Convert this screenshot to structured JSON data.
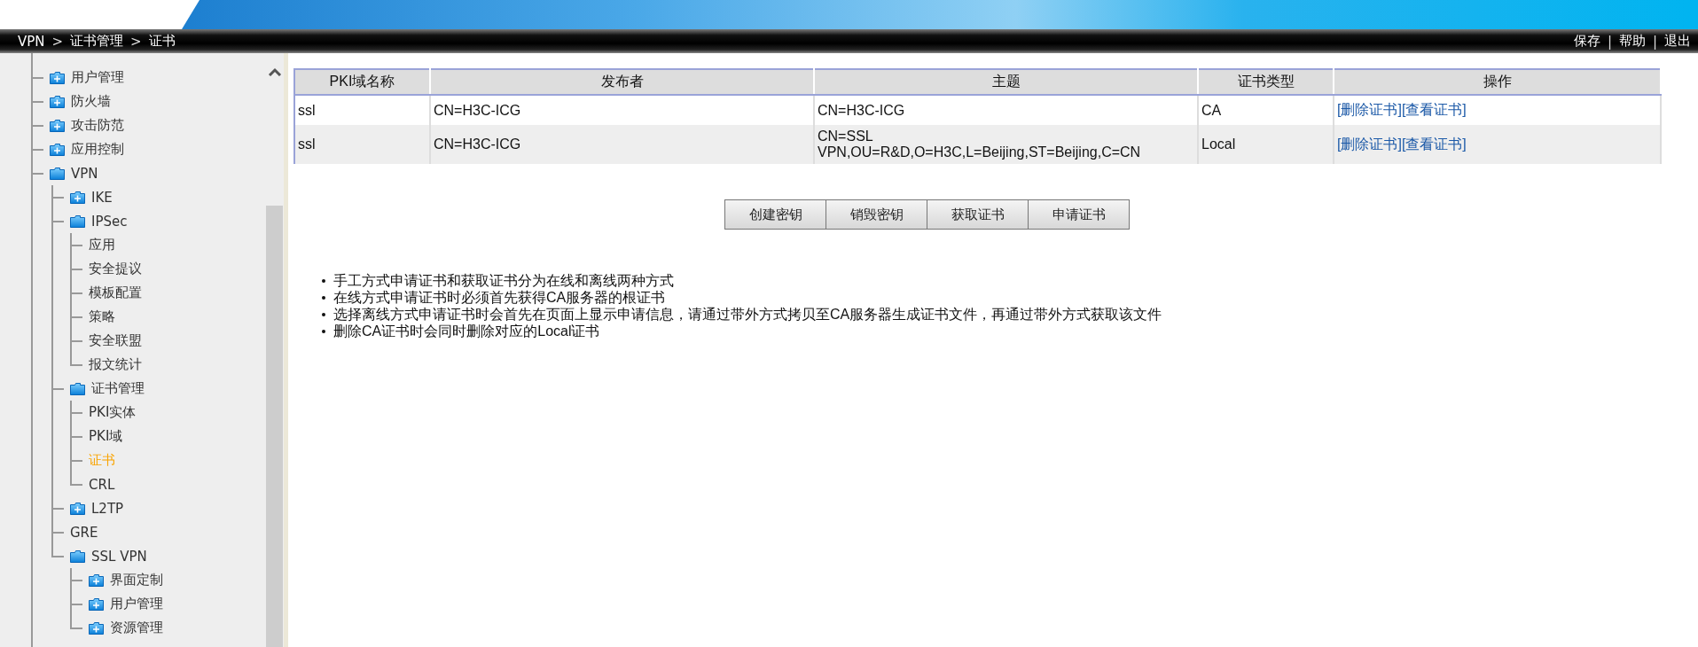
{
  "breadcrumb": [
    {
      "kind": "link",
      "text": "VPN"
    },
    {
      "kind": "separator",
      "text": ">"
    },
    {
      "kind": "link",
      "text": "证书管理"
    },
    {
      "kind": "separator",
      "text": ">"
    },
    {
      "kind": "current",
      "text": "证书"
    }
  ],
  "header_links": [
    {
      "kind": "link",
      "text": "保存"
    },
    {
      "kind": "separator",
      "text": "|"
    },
    {
      "kind": "link",
      "text": "帮助"
    },
    {
      "kind": "separator",
      "text": "|"
    },
    {
      "kind": "link",
      "text": "退出"
    }
  ],
  "sidebar": {
    "items": [
      {
        "label": "用户管理",
        "expanded": false,
        "selected": false
      },
      {
        "label": "防火墙",
        "expanded": false,
        "selected": false
      },
      {
        "label": "攻击防范",
        "expanded": false,
        "selected": false
      },
      {
        "label": "应用控制",
        "expanded": false,
        "selected": false
      },
      {
        "label": "VPN",
        "expanded": true,
        "selected": false,
        "children": [
          {
            "label": "IKE",
            "expanded": false,
            "selected": false
          },
          {
            "label": "IPSec",
            "expanded": true,
            "selected": false,
            "children": [
              {
                "label": "应用",
                "selected": false
              },
              {
                "label": "安全提议",
                "selected": false
              },
              {
                "label": "模板配置",
                "selected": false
              },
              {
                "label": "策略",
                "selected": false
              },
              {
                "label": "安全联盟",
                "selected": false
              },
              {
                "label": "报文统计",
                "selected": false
              }
            ]
          },
          {
            "label": "证书管理",
            "expanded": true,
            "selected": false,
            "children": [
              {
                "label": "PKI实体",
                "selected": false
              },
              {
                "label": "PKI域",
                "selected": false
              },
              {
                "label": "证书",
                "selected": true
              },
              {
                "label": "CRL",
                "selected": false
              }
            ]
          },
          {
            "label": "L2TP",
            "expanded": false,
            "selected": false
          },
          {
            "label": "GRE",
            "selected": false
          },
          {
            "label": "SSL VPN",
            "expanded": true,
            "selected": false,
            "children": [
              {
                "label": "界面定制",
                "expanded": false,
                "selected": false
              },
              {
                "label": "用户管理",
                "expanded": false,
                "selected": false
              },
              {
                "label": "资源管理",
                "expanded": false,
                "selected": false
              }
            ]
          }
        ]
      }
    ]
  },
  "table": {
    "columns": [
      "PKI域名称",
      "发布者",
      "主题",
      "证书类型",
      "操作"
    ],
    "rows": [
      {
        "domain": "ssl",
        "issuer": "CN=H3C-ICG",
        "subject": [
          "CN=H3C-ICG"
        ],
        "type": "CA",
        "actions": [
          "[删除证书]",
          "[查看证书]"
        ]
      },
      {
        "domain": "ssl",
        "issuer": "CN=H3C-ICG",
        "subject": [
          "CN=SSL",
          "VPN,OU=R&D,O=H3C,L=Beijing,ST=Beijing,C=CN"
        ],
        "type": "Local",
        "actions": [
          "[删除证书]",
          "[查看证书]"
        ]
      }
    ]
  },
  "buttons": [
    "创建密钥",
    "销毁密钥",
    "获取证书",
    "申请证书"
  ],
  "notes": [
    "手工方式申请证书和获取证书分为在线和离线两种方式",
    "在线方式申请证书时必须首先获得CA服务器的根证书",
    "选择离线方式申请证书时会首先在页面上显示申请信息，请通过带外方式拷贝至CA服务器生成证书文件，再通过带外方式获取该文件",
    "删除CA证书时会同时删除对应的Local证书"
  ]
}
